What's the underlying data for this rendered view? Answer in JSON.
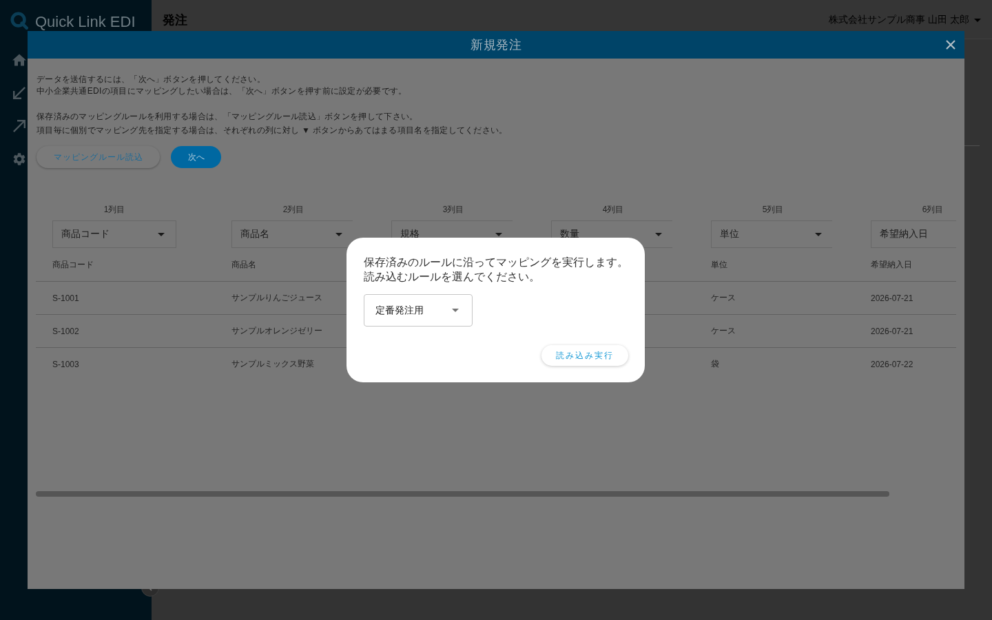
{
  "sidebar": {
    "logo": "Quick Link EDI"
  },
  "header": {
    "title": "発注",
    "user": "株式会社サンプル商事 山田 太郎"
  },
  "modal": {
    "title": "新規発注",
    "instructions": [
      [
        "データを送信するには、「次へ」ボタンを押してください。",
        "中小企業共通EDIの項目にマッピングしたい場合は、「次へ」ボタンを押す前に設定が必要です。"
      ],
      [
        "保存済みのマッピングルールを利用する場合は、「マッピングルール読込」ボタンを押して下さい。",
        "項目毎に個別でマッピング先を指定する場合は、それぞれの列に対し ▼ ボタンからあてはまる項目名を指定してください。"
      ]
    ],
    "buttons": [
      {
        "label": "マッピングルール読込",
        "kind": "outline"
      },
      {
        "label": "次へ",
        "kind": "primary"
      }
    ],
    "columns": [
      {
        "label": "1列目",
        "mapping": "商品コード",
        "header": "商品コード"
      },
      {
        "label": "2列目",
        "mapping": "商品名",
        "header": "商品名"
      },
      {
        "label": "3列目",
        "mapping": "規格"
      },
      {
        "label": "4列目",
        "mapping": "数量"
      },
      {
        "label": "5列目",
        "mapping": "単位",
        "header": "単位"
      },
      {
        "label": "6列目",
        "mapping": "希望納入日",
        "header": "希望納入日"
      }
    ],
    "rows": [
      {
        "column_1": "S-1001",
        "column_2": "サンプルりんごジュース",
        "column_5": "ケース",
        "column_6": "2026-07-21"
      },
      {
        "column_1": "S-1002",
        "column_2": "サンプルオレンジゼリー",
        "column_5": "ケース",
        "column_6": "2026-07-21"
      },
      {
        "column_1": "S-1003",
        "column_2": "サンプルミックス野菜",
        "column_5": "袋",
        "column_6": "2026-07-22"
      }
    ]
  },
  "dialog": {
    "message": [
      "保存済みのルールに沿ってマッピングを実行します。",
      "読み込むルールを選んでください。"
    ],
    "rule_select": {
      "value": "定番発注用"
    },
    "button": "読み込み実行"
  }
}
